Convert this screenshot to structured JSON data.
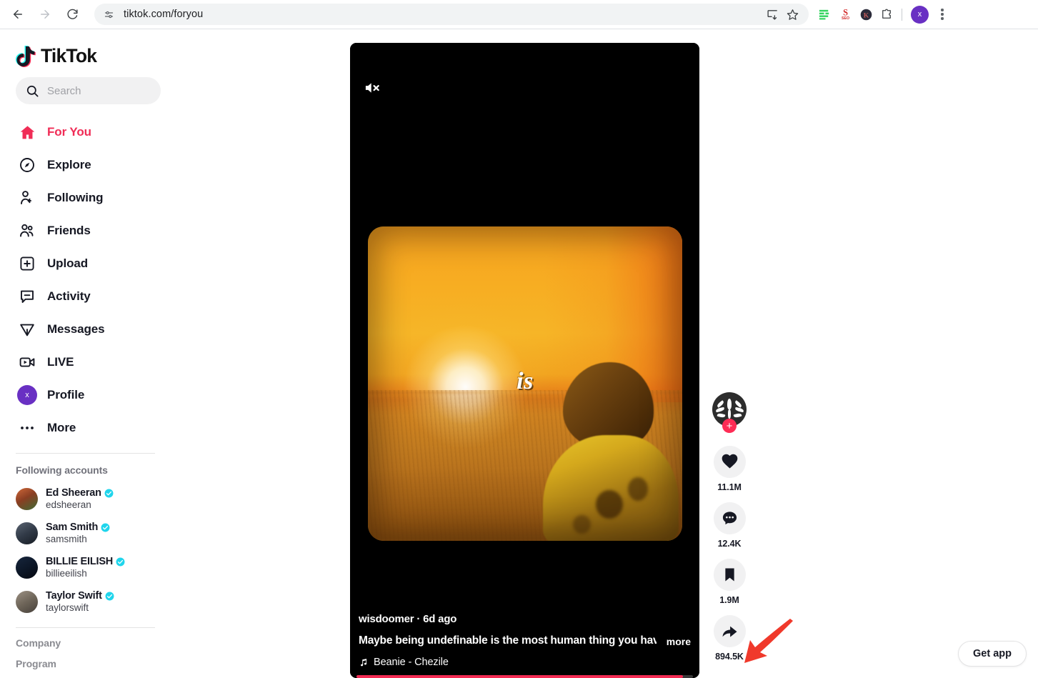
{
  "browser": {
    "url": "tiktok.com/foryou",
    "back_icon": "back-arrow-icon",
    "forward_icon": "forward-arrow-icon",
    "reload_icon": "reload-icon",
    "site_settings_icon": "tune-icon",
    "install_icon": "install-app-icon",
    "bookmark_icon": "star-icon",
    "extensions": [
      {
        "name": "grammarly-extension-icon",
        "color": "#35d461"
      },
      {
        "name": "seo-extension-icon",
        "color": "#d32b2b"
      },
      {
        "name": "k-extension-icon",
        "color": "#2b2b3a"
      },
      {
        "name": "puzzle-extensions-icon",
        "color": "#5f6368"
      }
    ],
    "profile_initial": "x",
    "menu_icon": "kebab-menu-icon"
  },
  "sidebar": {
    "logo_text": "TikTok",
    "logo_icon": "tiktok-note-icon",
    "search": {
      "placeholder": "Search",
      "value": "",
      "icon": "search-icon"
    },
    "nav": [
      {
        "label": "For You",
        "icon": "home-icon",
        "active": true
      },
      {
        "label": "Explore",
        "icon": "compass-icon",
        "active": false
      },
      {
        "label": "Following",
        "icon": "user-follow-icon",
        "active": false
      },
      {
        "label": "Friends",
        "icon": "friends-icon",
        "active": false
      },
      {
        "label": "Upload",
        "icon": "upload-plus-icon",
        "active": false
      },
      {
        "label": "Activity",
        "icon": "activity-icon",
        "active": false
      },
      {
        "label": "Messages",
        "icon": "paper-plane-icon",
        "active": false
      },
      {
        "label": "LIVE",
        "icon": "live-video-icon",
        "active": false
      },
      {
        "label": "Profile",
        "icon": "avatar-icon",
        "active": false
      },
      {
        "label": "More",
        "icon": "ellipsis-icon",
        "active": false
      }
    ],
    "profile_avatar_initial": "x",
    "following_title": "Following accounts",
    "accounts": [
      {
        "name": "Ed Sheeran",
        "handle": "edsheeran",
        "verified": true,
        "avatar_color": "#b4502e"
      },
      {
        "name": "Sam Smith",
        "handle": "samsmith",
        "verified": true,
        "avatar_color": "#3a4450"
      },
      {
        "name": "BILLIE EILISH",
        "handle": "billieeilish",
        "verified": true,
        "avatar_color": "#0d1b2e"
      },
      {
        "name": "Taylor Swift",
        "handle": "taylorswift",
        "verified": true,
        "avatar_color": "#7e7468"
      }
    ],
    "footer_links": [
      "Company",
      "Program"
    ]
  },
  "video": {
    "mute_icon": "speaker-muted-icon",
    "overlay_caption": "is",
    "author": "wisdoomer · 6d ago",
    "description": "Maybe being undefinable is the most human thing you have ...",
    "more_label": "more",
    "music_icon": "music-note-icon",
    "music": "Beanie - Chezile",
    "progress_percent": 97,
    "progress_color": "#f32b53"
  },
  "actions": {
    "avatar_icon": "wheat-crest-avatar",
    "follow_badge": "+",
    "items": [
      {
        "icon": "heart-icon",
        "count": "11.1M",
        "name": "like-button"
      },
      {
        "icon": "comment-icon",
        "count": "12.4K",
        "name": "comment-button"
      },
      {
        "icon": "bookmark-icon",
        "count": "1.9M",
        "name": "bookmark-button"
      },
      {
        "icon": "share-icon",
        "count": "894.5K",
        "name": "share-button"
      }
    ]
  },
  "annotation": {
    "arrow_icon": "red-pointer-arrow",
    "color": "#f0392b"
  },
  "get_app": {
    "label": "Get app"
  },
  "colors": {
    "brand_pink": "#fe2c55",
    "active_red": "#f02c56",
    "text_primary": "#161823",
    "muted": "#8a8b91",
    "chip_bg": "#f1f1f2"
  }
}
